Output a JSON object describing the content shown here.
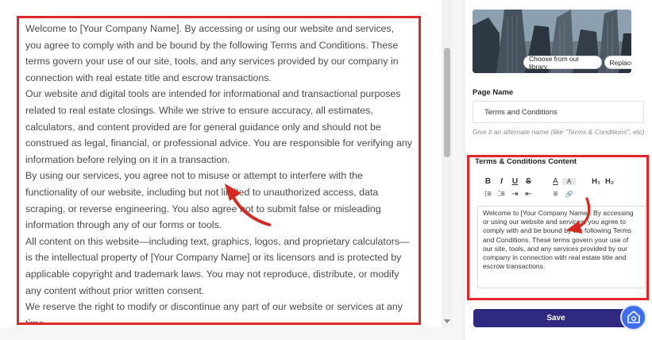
{
  "preview": {
    "paragraphs": [
      "Welcome to [Your Company Name]. By accessing or using our website and services, you agree to comply with and be bound by the following Terms and Conditions. These terms govern your use of our site, tools, and any services provided by our company in connection with real estate title and escrow transactions.",
      "Our website and digital tools are intended for informational and transactional purposes related to real estate closings. While we strive to ensure accuracy, all estimates, calculators, and content provided are for general guidance only and should not be construed as legal, financial, or professional advice. You are responsible for verifying any information before relying on it in a transaction.",
      "By using our services, you agree not to misuse or attempt to interfere with the functionality of our website, including but not limited to unauthorized access, data scraping, or reverse engineering. You also agree not to submit false or misleading information through any of our forms or tools.",
      "All content on this website—including text, graphics, logos, and proprietary calculators—is the intellectual property of [Your Company Name] or its licensors and is protected by applicable copyright and trademark laws. You may not reproduce, distribute, or modify any content without prior written consent.",
      "We reserve the right to modify or discontinue any part of our website or services at any time"
    ]
  },
  "image": {
    "choose_label": "Choose from our library",
    "replace_label": "Replace"
  },
  "page_name": {
    "label": "Page Name",
    "value": "Terms and Conditions",
    "hint": "Give it an alternate name (like \"Terms & Conditions\", etc)"
  },
  "content": {
    "label": "Terms & Conditions Content",
    "toolbar": {
      "bold": "B",
      "italic": "I",
      "underline": "U",
      "strike": "S",
      "text_color": "A",
      "highlight": "A",
      "h1": "H₁",
      "h2": "H₂",
      "ordered_list": "⁝≡",
      "bullet_list": "⁚≡",
      "indent": "⇥",
      "outdent": "⇤",
      "align": "≡",
      "link": "🔗"
    },
    "editor_text": "Welcome to [Your Company Name]. By accessing or using our website and services, you agree to comply with and be bound by the following Terms and Conditions. These terms govern your use of our site, tools, and any services provided by our company in connection with real estate title and escrow transactions."
  },
  "save_label": "Save",
  "colors": {
    "highlight_border": "#e3262c",
    "save_button": "#2f2a80",
    "support_button": "#3d6df2"
  },
  "icons": {
    "support": "support-chat-icon",
    "arrow": "red-annotation-arrow"
  }
}
